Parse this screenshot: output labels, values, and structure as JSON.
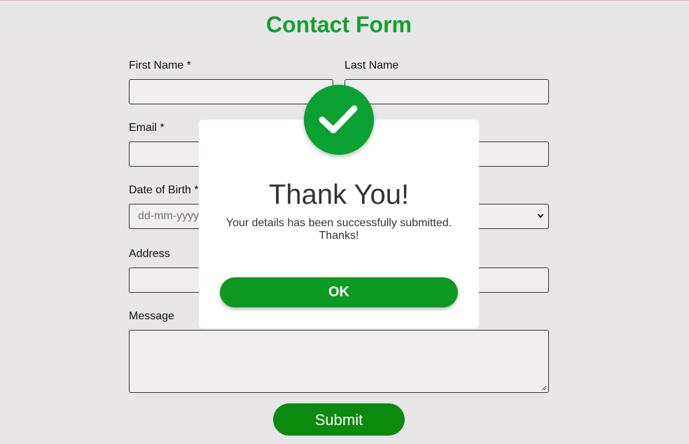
{
  "page": {
    "title": "Contact Form"
  },
  "form": {
    "first_name_label": "First Name *",
    "last_name_label": "Last Name",
    "email_label": "Email *",
    "dob_label": "Date of Birth *",
    "dob_placeholder": "dd-mm-yyyy",
    "address_label": "Address",
    "message_label": "Message",
    "submit_label": "Submit"
  },
  "modal": {
    "title": "Thank You!",
    "message_line1": "Your details has been successfully submitted.",
    "message_line2": "Thanks!",
    "ok_label": "OK",
    "icon": "checkmark-icon"
  },
  "colors": {
    "brand_green": "#12a12f",
    "button_green": "#0b8a0e",
    "ok_green": "#0e9a22",
    "check_circle": "#0aa133",
    "background": "#e8e6e7"
  }
}
